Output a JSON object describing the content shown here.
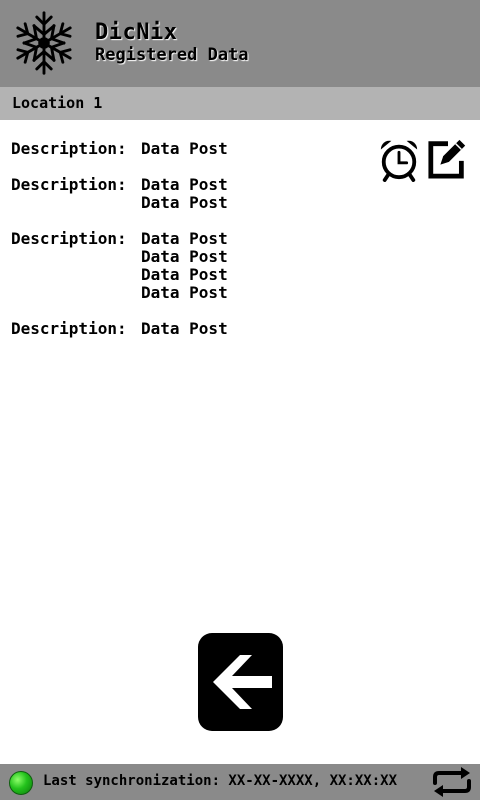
{
  "header": {
    "title": "DicNix",
    "subtitle": "Registered Data"
  },
  "location": {
    "label": "Location 1"
  },
  "entries": [
    {
      "label": "Description:",
      "posts": [
        "Data Post"
      ]
    },
    {
      "label": "Description:",
      "posts": [
        "Data Post",
        "Data Post"
      ]
    },
    {
      "label": "Description:",
      "posts": [
        "Data Post",
        "Data Post",
        "Data Post",
        "Data Post"
      ]
    },
    {
      "label": "Description:",
      "posts": [
        "Data Post"
      ]
    }
  ],
  "icons": {
    "logo": "snowflake-icon",
    "alarm": "alarm-clock-icon",
    "edit": "edit-icon",
    "back": "arrow-left-icon",
    "sync": "sync-icon"
  },
  "status": {
    "sync_text": "Last synchronization: XX-XX-XXXX, XX:XX:XX",
    "indicator_color": "#23c21c"
  },
  "colors": {
    "header_bg": "#8a8a8a",
    "location_bar_bg": "#b3b3b3",
    "status_bar_bg": "#8a8a8a"
  }
}
